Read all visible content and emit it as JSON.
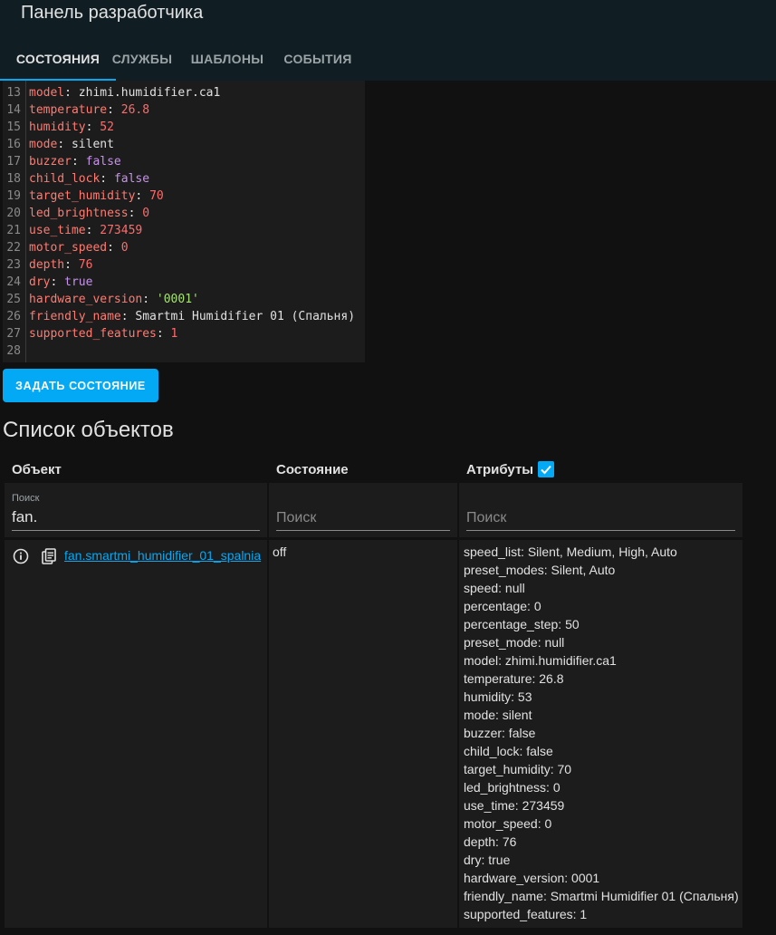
{
  "header": {
    "title": "Панель разработчика",
    "tabs": [
      {
        "label": "СОСТОЯНИЯ",
        "active": true
      },
      {
        "label": "СЛУЖБЫ",
        "active": false
      },
      {
        "label": "ШАБЛОНЫ",
        "active": false
      },
      {
        "label": "СОБЫТИЯ",
        "active": false
      }
    ]
  },
  "editor": {
    "lines": [
      {
        "n": "13",
        "key": "model",
        "value": "zhimi.humidifier.ca1",
        "kind": "str"
      },
      {
        "n": "14",
        "key": "temperature",
        "value": "26.8",
        "kind": "num"
      },
      {
        "n": "15",
        "key": "humidity",
        "value": "52",
        "kind": "num"
      },
      {
        "n": "16",
        "key": "mode",
        "value": "silent",
        "kind": "str"
      },
      {
        "n": "17",
        "key": "buzzer",
        "value": "false",
        "kind": "bool"
      },
      {
        "n": "18",
        "key": "child_lock",
        "value": "false",
        "kind": "bool"
      },
      {
        "n": "19",
        "key": "target_humidity",
        "value": "70",
        "kind": "num"
      },
      {
        "n": "20",
        "key": "led_brightness",
        "value": "0",
        "kind": "num"
      },
      {
        "n": "21",
        "key": "use_time",
        "value": "273459",
        "kind": "num"
      },
      {
        "n": "22",
        "key": "motor_speed",
        "value": "0",
        "kind": "num"
      },
      {
        "n": "23",
        "key": "depth",
        "value": "76",
        "kind": "num"
      },
      {
        "n": "24",
        "key": "dry",
        "value": "true",
        "kind": "bool"
      },
      {
        "n": "25",
        "key": "hardware_version",
        "value": "'0001'",
        "kind": "quoted"
      },
      {
        "n": "26",
        "key": "friendly_name",
        "value": "Smartmi Humidifier 01 (Спальня)",
        "kind": "str"
      },
      {
        "n": "27",
        "key": "supported_features",
        "value": "1",
        "kind": "num"
      },
      {
        "n": "28",
        "key": "",
        "value": "",
        "kind": "empty"
      }
    ]
  },
  "set_state_button": "ЗАДАТЬ СОСТОЯНИЕ",
  "entities_section": {
    "title": "Список объектов",
    "columns": {
      "entity": "Объект",
      "state": "Состояние",
      "attributes": "Атрибуты"
    },
    "attributes_checkbox_checked": true,
    "filters": {
      "entity_label": "Поиск",
      "entity_value": "fan.",
      "state_placeholder": "Поиск",
      "attributes_placeholder": "Поиск"
    },
    "row": {
      "entity_id": "fan.smartmi_humidifier_01_spalnia",
      "state": "off",
      "attributes": [
        "speed_list: Silent, Medium, High, Auto",
        "preset_modes: Silent, Auto",
        "speed: null",
        "percentage: 0",
        "percentage_step: 50",
        "preset_mode: null",
        "model: zhimi.humidifier.ca1",
        "temperature: 26.8",
        "humidity: 53",
        "mode: silent",
        "buzzer: false",
        "child_lock: false",
        "target_humidity: 70",
        "led_brightness: 0",
        "use_time: 273459",
        "motor_speed: 0",
        "depth: 76",
        "dry: true",
        "hardware_version: 0001",
        "friendly_name: Smartmi Humidifier 01 (Спальня)",
        "supported_features: 1"
      ]
    }
  },
  "colors": {
    "accent": "#03a9f4",
    "header_bg": "#101e24",
    "page_bg": "#111111",
    "card_bg": "#1c1c1c"
  }
}
